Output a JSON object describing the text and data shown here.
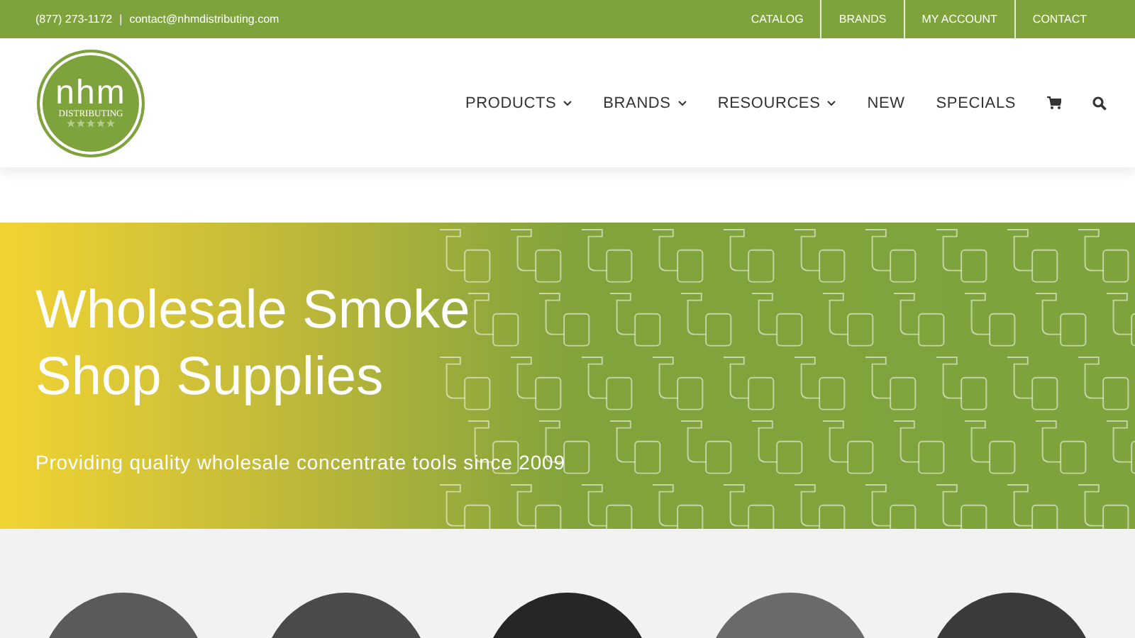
{
  "top_bar": {
    "phone": "(877) 273-1172",
    "separator": "|",
    "email": "contact@nhmdistributing.com",
    "links": [
      "CATALOG",
      "BRANDS",
      "MY ACCOUNT",
      "CONTACT"
    ]
  },
  "logo": {
    "wordmark": "nhm",
    "tagline": "DISTRIBUTING"
  },
  "nav": [
    {
      "label": "PRODUCTS",
      "kind": "dropdown"
    },
    {
      "label": "BRANDS",
      "kind": "dropdown"
    },
    {
      "label": "RESOURCES",
      "kind": "dropdown"
    },
    {
      "label": "NEW",
      "kind": "link"
    },
    {
      "label": "SPECIALS",
      "kind": "link"
    },
    {
      "kind": "cart"
    },
    {
      "kind": "search"
    }
  ],
  "hero": {
    "title": "Wholesale Smoke Shop Supplies",
    "subtitle": "Providing quality wholesale concentrate tools since 2009"
  },
  "categories": [
    {
      "kind": "photo"
    },
    {
      "kind": "photo"
    },
    {
      "kind": "photo"
    },
    {
      "kind": "photo"
    },
    {
      "kind": "photo"
    }
  ]
}
